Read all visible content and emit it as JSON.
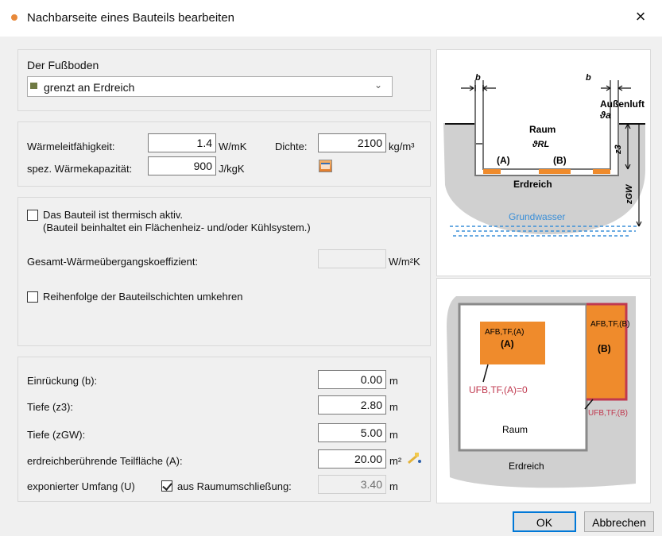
{
  "window": {
    "title": "Nachbarseite eines Bauteils bearbeiten",
    "close": "×"
  },
  "floor": {
    "group_label": "Der Fußboden",
    "selected": "grenzt an Erdreich",
    "icon": "ground-square-icon"
  },
  "material": {
    "conductivity_label": "Wärmeleitfähigkeit:",
    "conductivity_value": "1.4",
    "conductivity_unit": "W/mK",
    "density_label": "Dichte:",
    "density_value": "2100",
    "density_unit": "kg/m³",
    "heat_capacity_label": "spez. Wärmekapazität:",
    "heat_capacity_value": "900",
    "heat_capacity_unit": "J/kgK"
  },
  "thermal": {
    "active_line1": "Das Bauteil ist thermisch aktiv.",
    "active_line2": "(Bauteil beinhaltet ein Flächenheiz- und/oder Kühlsystem.)",
    "active_checked": false,
    "total_coeff_label": "Gesamt-Wärmeübergangskoeffizient:",
    "total_coeff_value": "",
    "total_coeff_unit": "W/m²K",
    "reverse_label": "Reihenfolge der Bauteilschichten umkehren",
    "reverse_checked": false
  },
  "geometry": {
    "indent_label": "Einrückung (b):",
    "indent_value": "0.00",
    "depth_z3_label": "Tiefe (z3):",
    "depth_z3_value": "2.80",
    "depth_zgw_label": "Tiefe (zGW):",
    "depth_zgw_value": "5.00",
    "area_label": "erdreichberührende Teilfläche (A):",
    "area_value": "20.00",
    "area_unit": "m²",
    "perimeter_label": "exponierter Umfang (U)",
    "from_room_label": "aus Raumumschließung:",
    "from_room_checked": true,
    "perimeter_value": "3.40",
    "unit_m": "m"
  },
  "diagram_section": {
    "b1": "b",
    "b2": "b",
    "outside_air": "Außenluft",
    "theta_a": "ϑa",
    "room": "Raum",
    "theta_rl": "ϑRL",
    "a": "(A)",
    "b": "(B)",
    "soil": "Erdreich",
    "z3": "z3",
    "zgw": "zGW",
    "groundwater": "Grundwasser"
  },
  "diagram_plan": {
    "a_fb_a": "AFB,TF,(A)",
    "a_label": "(A)",
    "a_fb_b": "AFB,TF,(B)",
    "b_label": "(B)",
    "u_a": "UFB,TF,(A)=0",
    "u_b": "UFB,TF,(B)",
    "room": "Raum",
    "soil": "Erdreich"
  },
  "buttons": {
    "ok": "OK",
    "cancel": "Abbrechen"
  },
  "colors": {
    "orange": "#ef8b2c",
    "red": "#c0394f",
    "blue": "#3a8fd8",
    "soil": "#d0d0d0"
  }
}
